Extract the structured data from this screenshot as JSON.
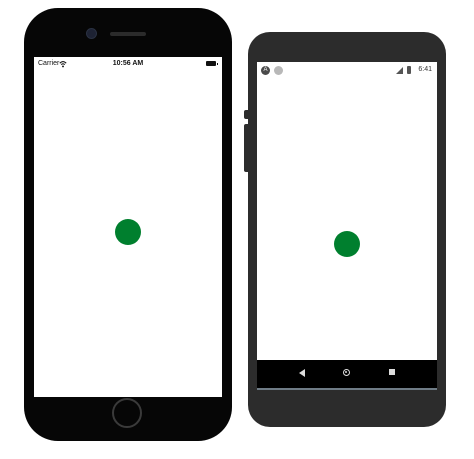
{
  "ios": {
    "carrier": "Carrier",
    "time": "10:56 AM",
    "icons": [
      "camera-icon",
      "wifi-icon",
      "battery-icon",
      "home-button-icon"
    ]
  },
  "android": {
    "time": "6:41",
    "icons": [
      "app-icon",
      "notification-icon",
      "signal-icon",
      "battery-icon",
      "back-icon",
      "home-icon",
      "recents-icon"
    ]
  },
  "colors": {
    "dot": "#007f2e",
    "iphone_body": "#060606",
    "android_body": "#2c2c2c",
    "screen": "#ffffff"
  }
}
